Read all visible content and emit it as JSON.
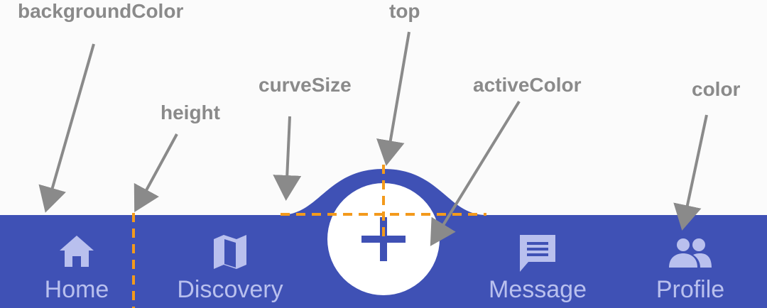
{
  "annotations": {
    "background_color": "backgroundColor",
    "top": "top",
    "curve_size": "curveSize",
    "active_color": "activeColor",
    "height": "height",
    "color": "color"
  },
  "nav": {
    "items": [
      {
        "label": "Home",
        "icon": "home-icon"
      },
      {
        "label": "Discovery",
        "icon": "map-icon"
      },
      {
        "label": "Message",
        "icon": "message-icon"
      },
      {
        "label": "Profile",
        "icon": "people-icon"
      }
    ],
    "center_button": {
      "icon": "plus-icon"
    }
  },
  "colors": {
    "bar": "#3f51b5",
    "page_background": "#fbfbfb",
    "inactive": "#b9c0ee",
    "center_button": "#ffffff",
    "guide": "#f39a1c",
    "annotation": "#8a8a8a"
  }
}
